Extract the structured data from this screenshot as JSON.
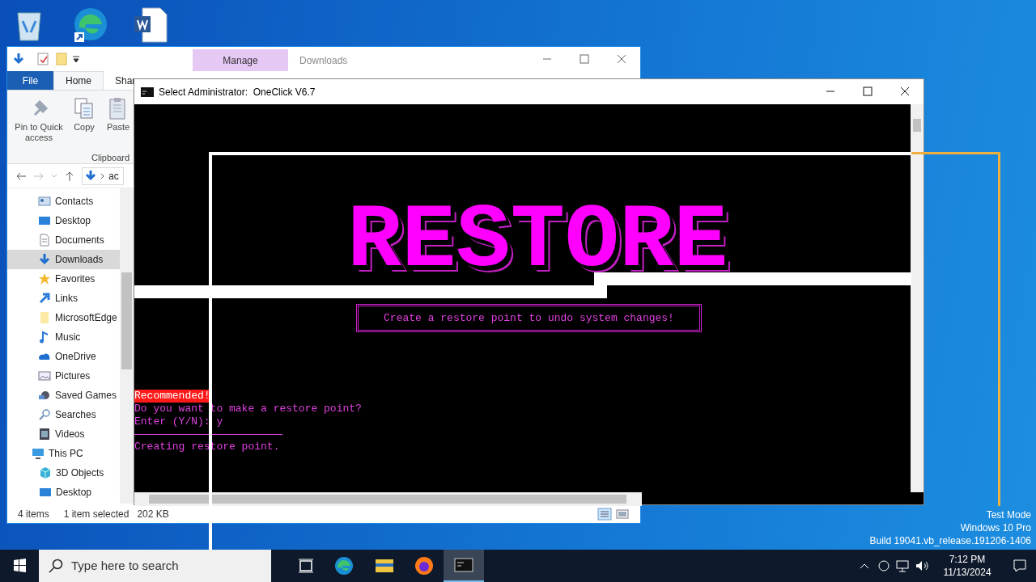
{
  "desktop": {
    "icons": [
      {
        "kind": "recycle"
      },
      {
        "kind": "edge"
      },
      {
        "kind": "word"
      }
    ],
    "watermark": [
      "Test Mode",
      "Windows 10 Pro",
      "Build 19041.vb_release.191206-1406"
    ]
  },
  "explorer": {
    "context_tab": "Manage",
    "title": "Downloads",
    "ribbon_tabs": [
      {
        "label": "File",
        "kind": "file",
        "selected": false
      },
      {
        "label": "Home",
        "kind": "tab",
        "selected": true
      },
      {
        "label": "Shar",
        "kind": "tab",
        "selected": false
      }
    ],
    "ribbon_buttons": [
      {
        "label": "Pin to Quick access",
        "kind": "pin"
      },
      {
        "label": "Copy",
        "kind": "copy"
      },
      {
        "label": "Paste",
        "kind": "paste"
      }
    ],
    "ribbon_group": "Clipboard",
    "address": "ac",
    "nav_items": [
      {
        "label": "Contacts",
        "kind": "contacts",
        "selected": false
      },
      {
        "label": "Desktop",
        "kind": "desktop",
        "selected": false
      },
      {
        "label": "Documents",
        "kind": "documents",
        "selected": false
      },
      {
        "label": "Downloads",
        "kind": "downloads",
        "selected": true
      },
      {
        "label": "Favorites",
        "kind": "star",
        "selected": false
      },
      {
        "label": "Links",
        "kind": "links",
        "selected": false
      },
      {
        "label": "MicrosoftEdge",
        "kind": "folder",
        "selected": false
      },
      {
        "label": "Music",
        "kind": "music",
        "selected": false
      },
      {
        "label": "OneDrive",
        "kind": "cloud",
        "selected": false
      },
      {
        "label": "Pictures",
        "kind": "pictures",
        "selected": false
      },
      {
        "label": "Saved Games",
        "kind": "games",
        "selected": false
      },
      {
        "label": "Searches",
        "kind": "search",
        "selected": false
      },
      {
        "label": "Videos",
        "kind": "videos",
        "selected": false
      },
      {
        "label": "This PC",
        "kind": "pc",
        "selected": false,
        "children": [
          {
            "label": "3D Objects",
            "kind": "cube",
            "selected": false
          },
          {
            "label": "Desktop",
            "kind": "desktop",
            "selected": false
          }
        ]
      }
    ],
    "status": {
      "items": "4 items",
      "selection": "1 item selected",
      "size": "202 KB"
    }
  },
  "console": {
    "title": "Select Administrator:  OneClick V6.7",
    "banner": "RESTORE",
    "subtitle": "Create a restore point to undo system changes!",
    "lines": [
      {
        "text": "Recommended!",
        "kind": "badge"
      },
      {
        "text": "Do you want to make a restore point?",
        "kind": "text"
      },
      {
        "text": "Enter (Y/N): y",
        "kind": "text"
      },
      {
        "kind": "rule"
      },
      {
        "text": "Creating restore point.",
        "kind": "text"
      }
    ]
  },
  "taskbar": {
    "search_placeholder": "Type here to search",
    "apps": [
      {
        "kind": "taskview",
        "selected": false
      },
      {
        "kind": "edge",
        "selected": false
      },
      {
        "kind": "explorer",
        "selected": false
      },
      {
        "kind": "firefox",
        "selected": false
      },
      {
        "kind": "console",
        "selected": true
      }
    ],
    "time": "7:12 PM",
    "date": "11/13/2024"
  }
}
